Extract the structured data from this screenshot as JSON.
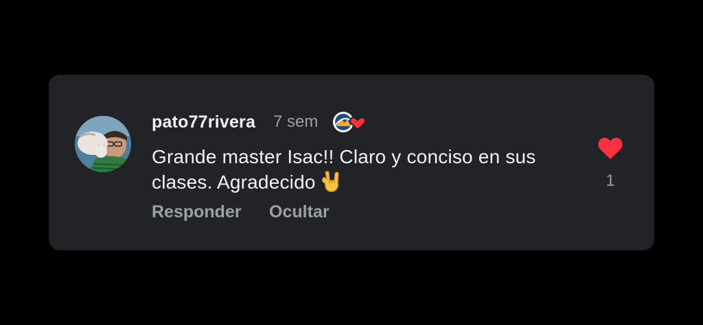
{
  "comment": {
    "username": "pato77rivera",
    "time_ago": "7 sem",
    "text": "Grande master Isac!! Claro y conciso en sus clases. Agradecido",
    "actions": {
      "reply_label": "Responder",
      "hide_label": "Ocultar"
    },
    "likes": {
      "count": "1",
      "liked": true
    },
    "icons": {
      "avatar": "user-avatar",
      "badge": "creator-heart-badge-icon",
      "emoji": "rock-hand-emoji-icon",
      "like": "heart-icon"
    },
    "colors": {
      "background": "#222327",
      "heart": "#ff3040",
      "muted_text": "#9aa0a6"
    }
  }
}
